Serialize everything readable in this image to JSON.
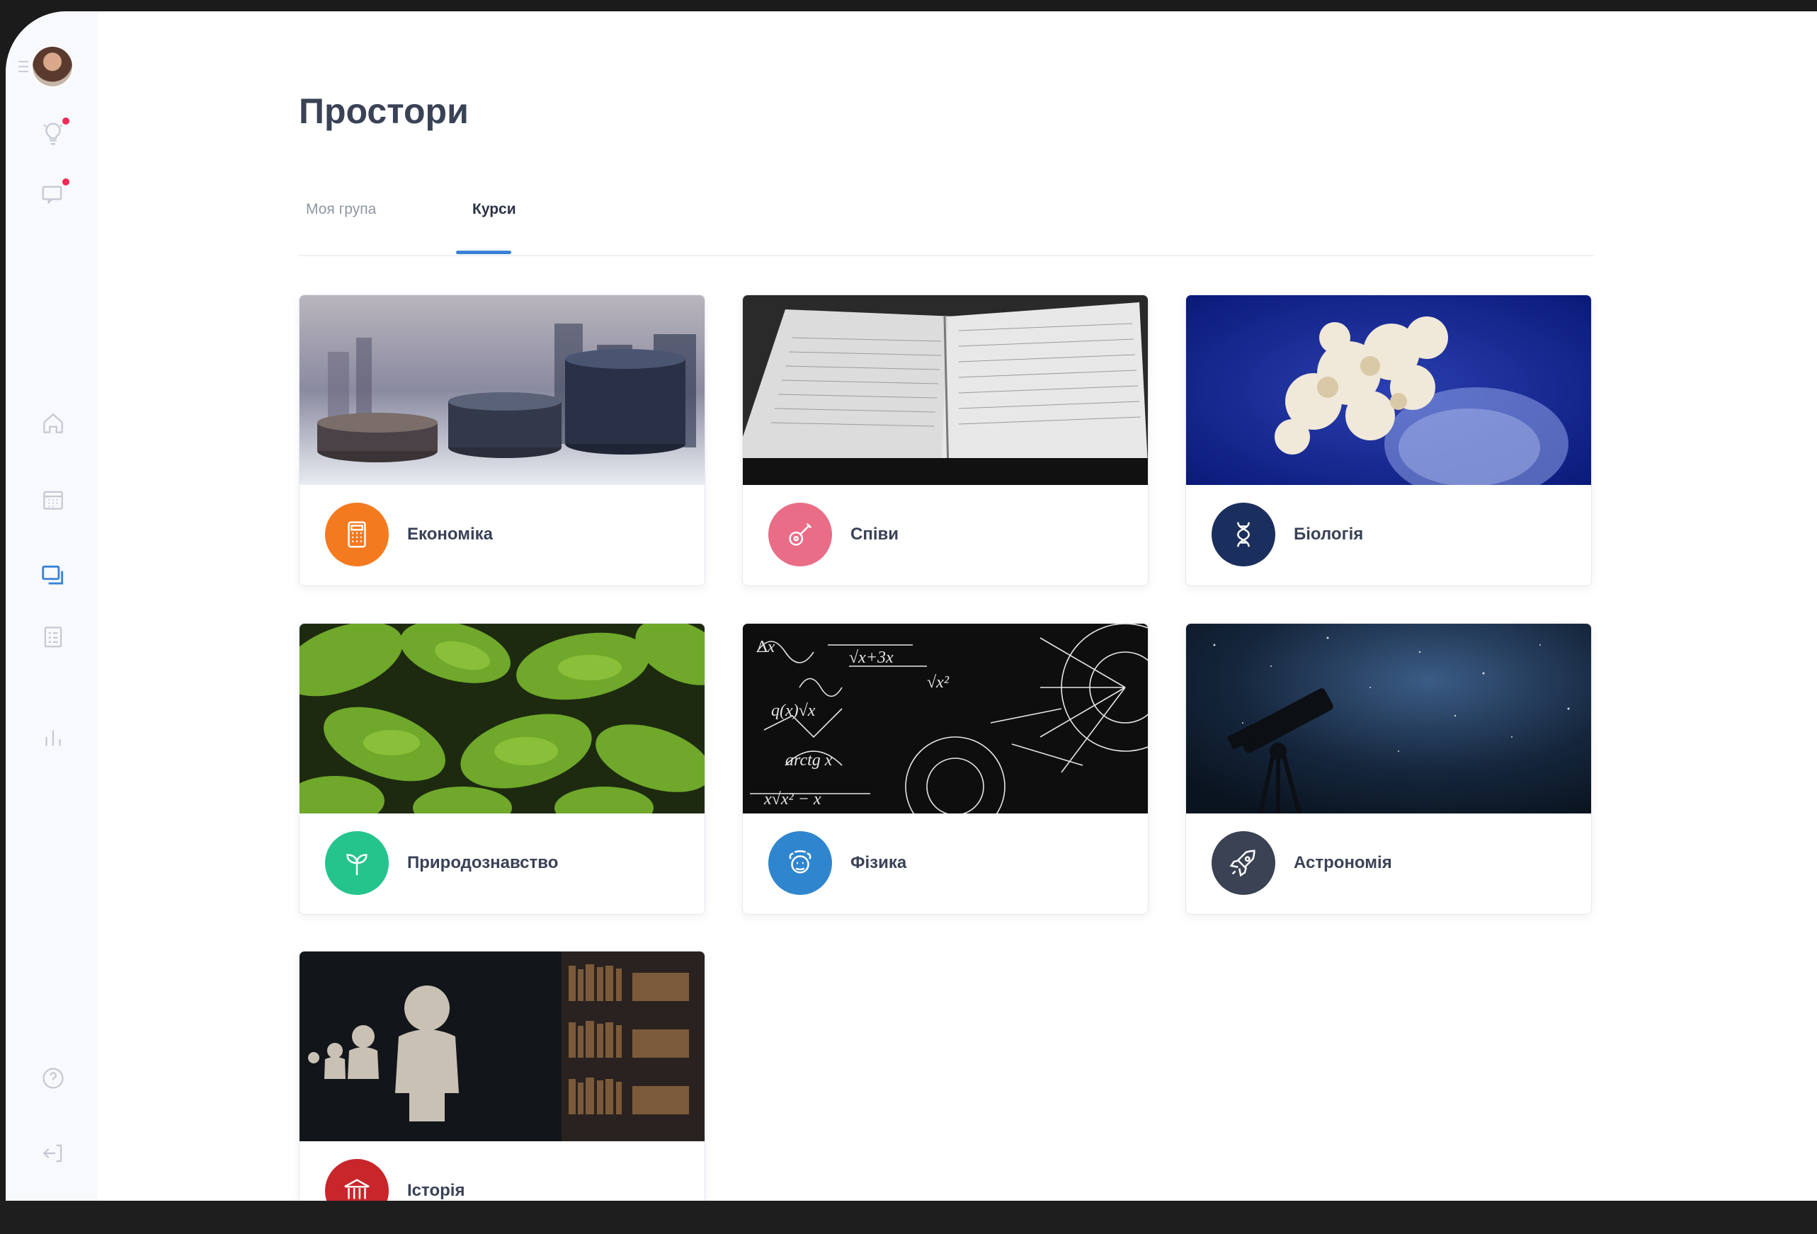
{
  "page": {
    "title": "Простори"
  },
  "tabs": [
    {
      "label": "Моя група",
      "active": false
    },
    {
      "label": "Курси",
      "active": true
    }
  ],
  "sidebar": {
    "items": [
      {
        "icon": "lightbulb-icon",
        "badge": true
      },
      {
        "icon": "chat-icon",
        "badge": true
      },
      {
        "icon": "home-icon"
      },
      {
        "icon": "calendar-icon"
      },
      {
        "icon": "spaces-icon",
        "active": true
      },
      {
        "icon": "tasks-icon"
      },
      {
        "icon": "stats-icon"
      },
      {
        "icon": "help-icon"
      },
      {
        "icon": "logout-icon"
      }
    ]
  },
  "courses": [
    {
      "label": "Економіка",
      "icon": "calculator-icon",
      "color": "#f47a20"
    },
    {
      "label": "Співи",
      "icon": "guitar-icon",
      "color": "#e96d87"
    },
    {
      "label": "Біологія",
      "icon": "dna-icon",
      "color": "#1b2f5e"
    },
    {
      "label": "Природознавство",
      "icon": "sprout-icon",
      "color": "#25c48c"
    },
    {
      "label": "Фізика",
      "icon": "einstein-icon",
      "color": "#2f86cf"
    },
    {
      "label": "Астрономія",
      "icon": "rocket-icon",
      "color": "#3b4254"
    },
    {
      "label": "Історія",
      "icon": "museum-icon",
      "color": "#c8262a"
    }
  ],
  "colors": {
    "accent": "#3b82d6",
    "badge": "#ee2a55",
    "title": "#3a4256"
  }
}
